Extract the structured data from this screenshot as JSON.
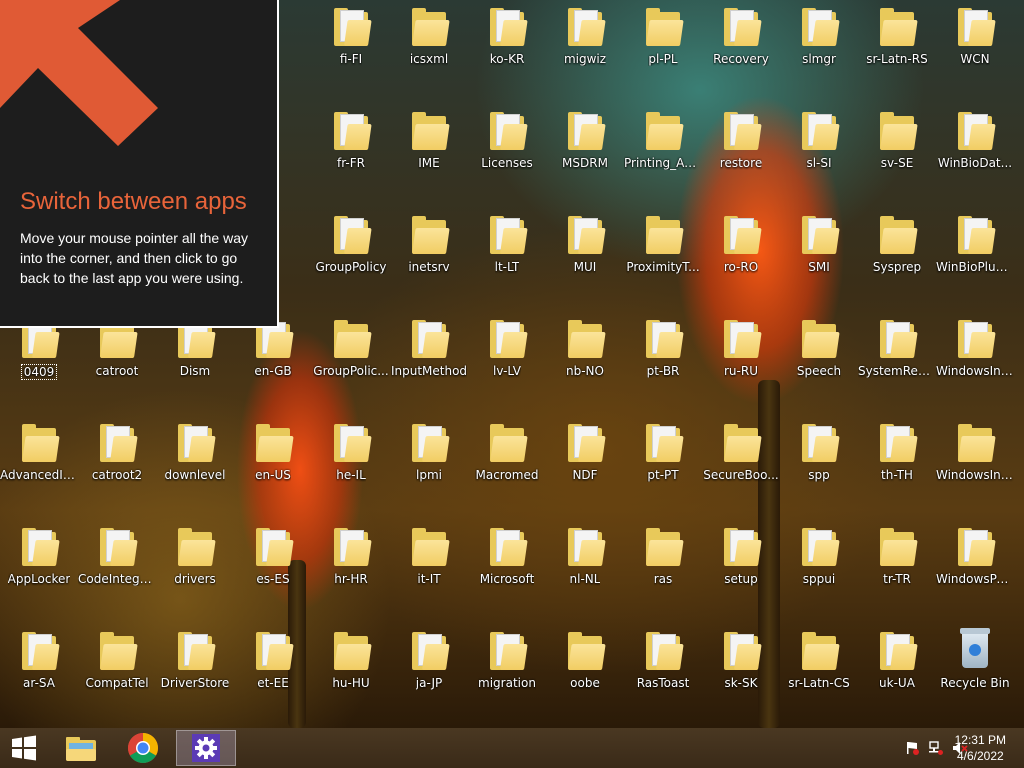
{
  "tip": {
    "title": "Switch between apps",
    "body": "Move your mouse pointer all the way into the corner, and then click to go back to the last app you were using.",
    "accent": "#e8643a"
  },
  "desktop": {
    "icons": [
      {
        "label": "fi-FI",
        "col": 4,
        "row": 0
      },
      {
        "label": "icsxml",
        "col": 5,
        "row": 0
      },
      {
        "label": "ko-KR",
        "col": 6,
        "row": 0
      },
      {
        "label": "migwiz",
        "col": 7,
        "row": 0
      },
      {
        "label": "pl-PL",
        "col": 8,
        "row": 0
      },
      {
        "label": "Recovery",
        "col": 9,
        "row": 0
      },
      {
        "label": "slmgr",
        "col": 10,
        "row": 0
      },
      {
        "label": "sr-Latn-RS",
        "col": 11,
        "row": 0
      },
      {
        "label": "WCN",
        "col": 12,
        "row": 0
      },
      {
        "label": "fr-FR",
        "col": 4,
        "row": 1
      },
      {
        "label": "IME",
        "col": 5,
        "row": 1
      },
      {
        "label": "Licenses",
        "col": 6,
        "row": 1
      },
      {
        "label": "MSDRM",
        "col": 7,
        "row": 1
      },
      {
        "label": "Printing_Ad...",
        "col": 8,
        "row": 1
      },
      {
        "label": "restore",
        "col": 9,
        "row": 1
      },
      {
        "label": "sl-SI",
        "col": 10,
        "row": 1
      },
      {
        "label": "sv-SE",
        "col": 11,
        "row": 1
      },
      {
        "label": "WinBioDat...",
        "col": 12,
        "row": 1
      },
      {
        "label": "GroupPolicy",
        "col": 4,
        "row": 2
      },
      {
        "label": "inetsrv",
        "col": 5,
        "row": 2
      },
      {
        "label": "lt-LT",
        "col": 6,
        "row": 2
      },
      {
        "label": "MUI",
        "col": 7,
        "row": 2
      },
      {
        "label": "ProximityT...",
        "col": 8,
        "row": 2
      },
      {
        "label": "ro-RO",
        "col": 9,
        "row": 2
      },
      {
        "label": "SMI",
        "col": 10,
        "row": 2
      },
      {
        "label": "Sysprep",
        "col": 11,
        "row": 2
      },
      {
        "label": "WinBioPlug...",
        "col": 12,
        "row": 2
      },
      {
        "label": "0409",
        "col": 0,
        "row": 3,
        "selected": true
      },
      {
        "label": "catroot",
        "col": 1,
        "row": 3
      },
      {
        "label": "Dism",
        "col": 2,
        "row": 3
      },
      {
        "label": "en-GB",
        "col": 3,
        "row": 3
      },
      {
        "label": "GroupPolic...",
        "col": 4,
        "row": 3
      },
      {
        "label": "InputMethod",
        "col": 5,
        "row": 3
      },
      {
        "label": "lv-LV",
        "col": 6,
        "row": 3
      },
      {
        "label": "nb-NO",
        "col": 7,
        "row": 3
      },
      {
        "label": "pt-BR",
        "col": 8,
        "row": 3
      },
      {
        "label": "ru-RU",
        "col": 9,
        "row": 3
      },
      {
        "label": "Speech",
        "col": 10,
        "row": 3
      },
      {
        "label": "SystemRese...",
        "col": 11,
        "row": 3
      },
      {
        "label": "WindowsInt...",
        "col": 12,
        "row": 3
      },
      {
        "label": "AdvancedIn...",
        "col": 0,
        "row": 4
      },
      {
        "label": "catroot2",
        "col": 1,
        "row": 4
      },
      {
        "label": "downlevel",
        "col": 2,
        "row": 4
      },
      {
        "label": "en-US",
        "col": 3,
        "row": 4
      },
      {
        "label": "he-IL",
        "col": 4,
        "row": 4
      },
      {
        "label": "lpmi",
        "col": 5,
        "row": 4
      },
      {
        "label": "Macromed",
        "col": 6,
        "row": 4
      },
      {
        "label": "NDF",
        "col": 7,
        "row": 4
      },
      {
        "label": "pt-PT",
        "col": 8,
        "row": 4
      },
      {
        "label": "SecureBoo...",
        "col": 9,
        "row": 4
      },
      {
        "label": "spp",
        "col": 10,
        "row": 4
      },
      {
        "label": "th-TH",
        "col": 11,
        "row": 4
      },
      {
        "label": "WindowsInt...",
        "col": 12,
        "row": 4
      },
      {
        "label": "AppLocker",
        "col": 0,
        "row": 5
      },
      {
        "label": "CodeIntegrity",
        "col": 1,
        "row": 5
      },
      {
        "label": "drivers",
        "col": 2,
        "row": 5
      },
      {
        "label": "es-ES",
        "col": 3,
        "row": 5
      },
      {
        "label": "hr-HR",
        "col": 4,
        "row": 5
      },
      {
        "label": "it-IT",
        "col": 5,
        "row": 5
      },
      {
        "label": "Microsoft",
        "col": 6,
        "row": 5
      },
      {
        "label": "nl-NL",
        "col": 7,
        "row": 5
      },
      {
        "label": "ras",
        "col": 8,
        "row": 5
      },
      {
        "label": "setup",
        "col": 9,
        "row": 5
      },
      {
        "label": "sppui",
        "col": 10,
        "row": 5
      },
      {
        "label": "tr-TR",
        "col": 11,
        "row": 5
      },
      {
        "label": "WindowsPo...",
        "col": 12,
        "row": 5
      },
      {
        "label": "ar-SA",
        "col": 0,
        "row": 6
      },
      {
        "label": "CompatTel",
        "col": 1,
        "row": 6
      },
      {
        "label": "DriverStore",
        "col": 2,
        "row": 6
      },
      {
        "label": "et-EE",
        "col": 3,
        "row": 6
      },
      {
        "label": "hu-HU",
        "col": 4,
        "row": 6
      },
      {
        "label": "ja-JP",
        "col": 5,
        "row": 6
      },
      {
        "label": "migration",
        "col": 6,
        "row": 6
      },
      {
        "label": "oobe",
        "col": 7,
        "row": 6
      },
      {
        "label": "RasToast",
        "col": 8,
        "row": 6
      },
      {
        "label": "sk-SK",
        "col": 9,
        "row": 6
      },
      {
        "label": "sr-Latn-CS",
        "col": 10,
        "row": 6
      },
      {
        "label": "uk-UA",
        "col": 11,
        "row": 6
      },
      {
        "label": "Recycle Bin",
        "col": 12,
        "row": 6,
        "kind": "recycle-bin"
      }
    ]
  },
  "taskbar": {
    "start_icon": "windows-logo-icon",
    "pinned": [
      "file-explorer-icon",
      "chrome-icon",
      "settings-gear-icon"
    ],
    "tray": [
      "action-center-flag-icon",
      "network-icon",
      "volume-muted-icon"
    ],
    "time": "12:31 PM",
    "date": "4/6/2022"
  }
}
